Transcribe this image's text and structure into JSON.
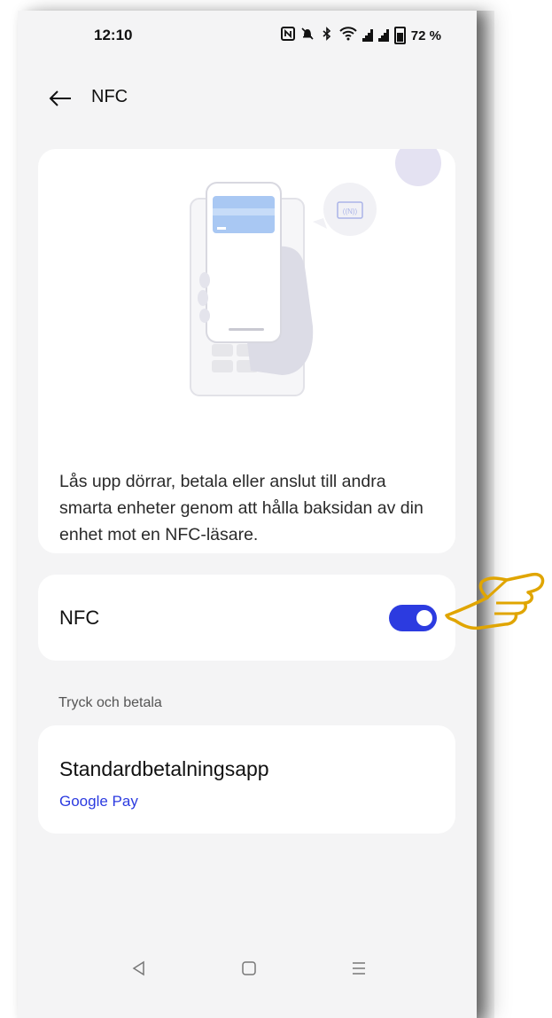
{
  "status_bar": {
    "time": "12:10",
    "battery_percent": "72 %",
    "icons": [
      "nfc-icon",
      "mute-icon",
      "bluetooth-icon",
      "wifi-icon",
      "signal-icon",
      "signal-icon",
      "battery-icon"
    ]
  },
  "header": {
    "back_icon": "arrow-left-icon",
    "title": "NFC"
  },
  "intro_card": {
    "illustration": "nfc-payment-illustration",
    "description": "Lås upp dörrar, betala eller anslut till andra smarta enheter genom att hålla baksidan av din enhet mot en NFC-läsare."
  },
  "nfc_setting": {
    "label": "NFC",
    "enabled": true,
    "toggle_color": "#2c3be0"
  },
  "tap_and_pay": {
    "section_label": "Tryck och betala",
    "default_app_title": "Standardbetalningsapp",
    "default_app_value": "Google Pay",
    "value_color": "#2c3be0"
  },
  "nav_bar": {
    "icons": [
      "back-triangle-icon",
      "home-square-icon",
      "menu-lines-icon"
    ]
  },
  "annotation": {
    "icon": "pointing-hand-icon",
    "color": "#e0a500"
  }
}
